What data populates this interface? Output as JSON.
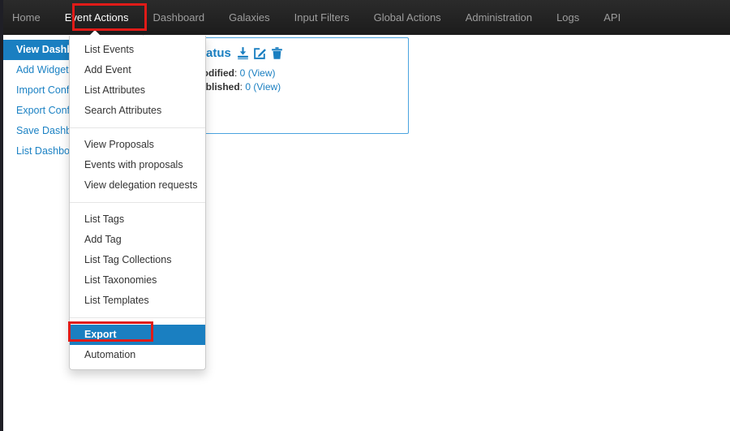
{
  "navbar": {
    "items": [
      {
        "label": "Home",
        "active": false
      },
      {
        "label": "Event Actions",
        "active": true
      },
      {
        "label": "Dashboard",
        "active": false
      },
      {
        "label": "Galaxies",
        "active": false
      },
      {
        "label": "Input Filters",
        "active": false
      },
      {
        "label": "Global Actions",
        "active": false
      },
      {
        "label": "Administration",
        "active": false
      },
      {
        "label": "Logs",
        "active": false
      },
      {
        "label": "API",
        "active": false
      }
    ],
    "highlight_color": "#e01b18",
    "background_color": "#222222"
  },
  "sidebar": {
    "items": [
      {
        "label": "View Dashboard",
        "active": true
      },
      {
        "label": "Add Widget",
        "active": false
      },
      {
        "label": "Import Config",
        "active": false
      },
      {
        "label": "Export Config",
        "active": false
      },
      {
        "label": "Save Dashboard",
        "active": false
      },
      {
        "label": "List Dashboards",
        "active": false
      }
    ],
    "link_color": "#1c82c4",
    "active_background": "#1a7fc1"
  },
  "panel": {
    "title": "Status",
    "icons": [
      {
        "name": "download-icon"
      },
      {
        "name": "edit-icon"
      },
      {
        "name": "delete-icon"
      }
    ],
    "rows": [
      {
        "label": "modified",
        "separator": ": ",
        "value": "0",
        "link": "(View)"
      },
      {
        "label": "published",
        "separator": ": ",
        "value": "0",
        "link": "(View)"
      }
    ],
    "border_color": "#4aa3df",
    "accent_color": "#1a7fc1"
  },
  "dropdown": {
    "owner": "Event Actions",
    "groups": [
      {
        "items": [
          {
            "label": "List Events",
            "highlight": false
          },
          {
            "label": "Add Event",
            "highlight": false
          },
          {
            "label": "List Attributes",
            "highlight": false
          },
          {
            "label": "Search Attributes",
            "highlight": false
          }
        ]
      },
      {
        "items": [
          {
            "label": "View Proposals",
            "highlight": false
          },
          {
            "label": "Events with proposals",
            "highlight": false
          },
          {
            "label": "View delegation requests",
            "highlight": false
          }
        ]
      },
      {
        "items": [
          {
            "label": "List Tags",
            "highlight": false
          },
          {
            "label": "Add Tag",
            "highlight": false
          },
          {
            "label": "List Tag Collections",
            "highlight": false
          },
          {
            "label": "List Taxonomies",
            "highlight": false
          },
          {
            "label": "List Templates",
            "highlight": false
          }
        ]
      },
      {
        "items": [
          {
            "label": "Export",
            "highlight": true
          },
          {
            "label": "Automation",
            "highlight": false
          }
        ]
      }
    ],
    "highlight_background": "#1a7fc1"
  },
  "annotations": [
    {
      "name": "red-box-event-actions",
      "target": "Event Actions",
      "color": "#e01b18"
    },
    {
      "name": "red-box-export",
      "target": "Export",
      "color": "#e01b18"
    }
  ]
}
